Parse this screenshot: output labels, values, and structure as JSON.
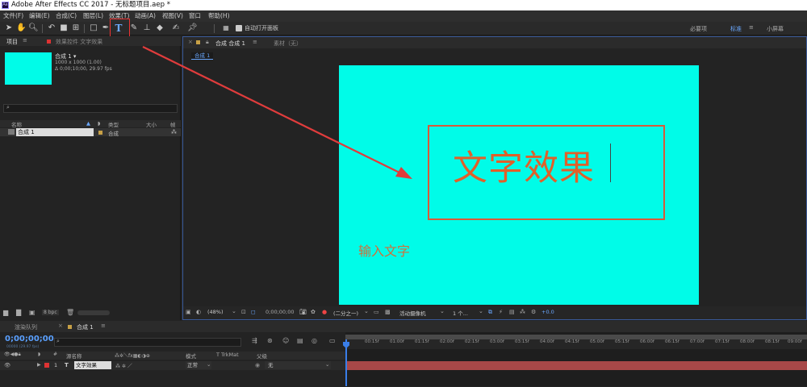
{
  "app": {
    "title": "Adobe After Effects CC 2017 - 无标题项目.aep *",
    "logo": "Ae"
  },
  "menu": [
    "文件(F)",
    "编辑(E)",
    "合成(C)",
    "图层(L)",
    "效果(T)",
    "动画(A)",
    "视图(V)",
    "窗口",
    "帮助(H)"
  ],
  "toolbar": {
    "auto_open": "自动打开面板",
    "ws": [
      "必要项",
      "标准",
      "小屏幕"
    ],
    "tools": [
      "selection-icon",
      "hand-icon",
      "zoom-icon",
      "rotate-icon",
      "camera-icon",
      "pan-behind-icon",
      "rectangle-icon",
      "pen-icon",
      "type-icon",
      "brush-icon",
      "clone-stamp-icon",
      "eraser-icon",
      "puppet-pin-icon"
    ]
  },
  "project": {
    "tab": "项目",
    "effects_tab": "效果控件 文字效果",
    "comp_name": "合成 1 ▾",
    "comp_size": "1000 x 1000 (1.00)",
    "comp_dur": "Δ 0;00;10;00, 29.97 fps",
    "search_placeholder": "",
    "col_name": "名称",
    "col_type": "类型",
    "col_size": "大小",
    "col_frame": "帧速",
    "item_name": "合成 1",
    "item_type": "合成",
    "bpc": "8 bpc",
    "item_color": "#c7a046"
  },
  "viewer": {
    "tab": "合成 合成 1",
    "footage_tab": "素材（无）",
    "crumb": "合成 1",
    "main_text": "文字效果",
    "hint_text": "输入文字",
    "bg": "#00fce8",
    "text_color": "#e0602a",
    "footer": {
      "zoom": "(48%)",
      "time": "0;00;00;00",
      "res": "(二分之一)",
      "camera": "活动摄像机",
      "views": "1 个...",
      "exposure": "+0.0"
    }
  },
  "timeline": {
    "queue_tab": "渲染队列",
    "comp_tab": "合成 1",
    "timecode": "0;00;00;00",
    "fps": "00000 (29.97 fps)",
    "headers": {
      "src": "源名称",
      "mode": "模式",
      "trk": "T  TrkMat",
      "parent": "父级"
    },
    "layer": {
      "num": "1",
      "name": "文字效果",
      "mode": "正常",
      "parent": "无"
    },
    "ticks": [
      "00:15f",
      "01:00f",
      "01:15f",
      "02:00f",
      "02:15f",
      "03:00f",
      "03:15f",
      "04:00f",
      "04:15f",
      "05:00f",
      "05:15f",
      "06:00f",
      "06:15f",
      "07:00f",
      "07:15f",
      "08:00f",
      "08:15f",
      "09:00f"
    ]
  }
}
